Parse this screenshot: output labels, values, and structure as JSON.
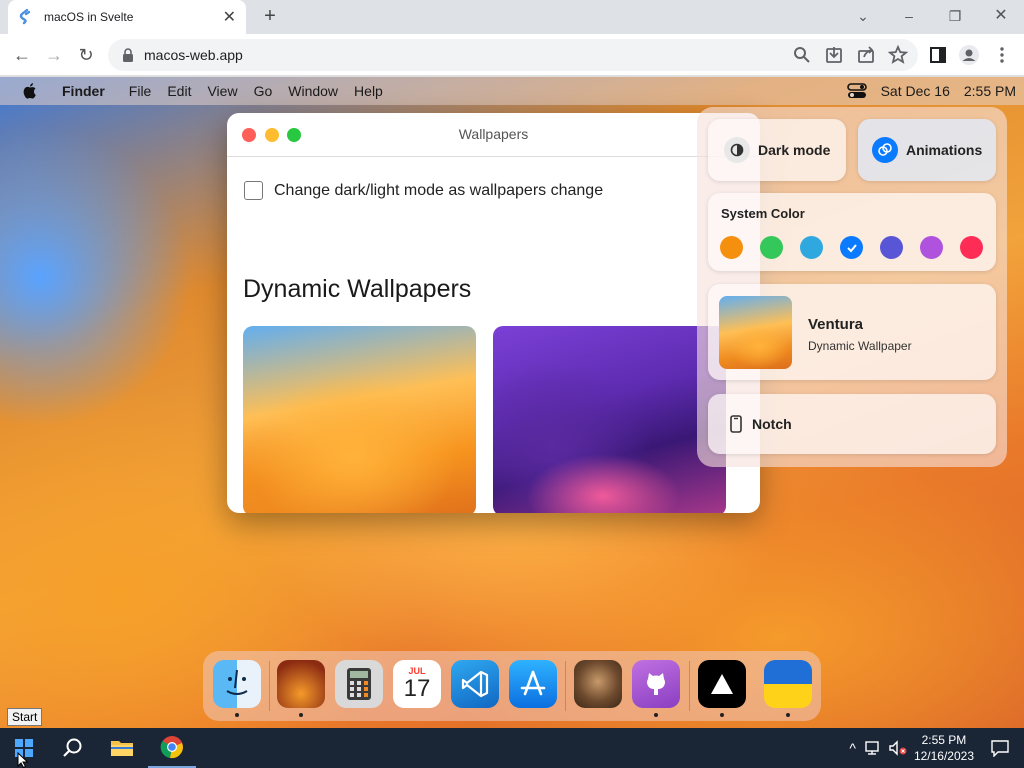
{
  "browser": {
    "tab_title": "macOS in Svelte",
    "url": "macos-web.app"
  },
  "menubar": {
    "app_name": "Finder",
    "items": [
      "File",
      "Edit",
      "View",
      "Go",
      "Window",
      "Help"
    ],
    "date": "Sat Dec 16",
    "time": "2:55 PM"
  },
  "wallpapers_window": {
    "title": "Wallpapers",
    "checkbox_label": "Change dark/light mode as wallpapers change",
    "checkbox_checked": false,
    "section_heading": "Dynamic Wallpapers"
  },
  "control_center": {
    "dark_mode_label": "Dark mode",
    "animations_label": "Animations",
    "system_color_label": "System Color",
    "colors": [
      "#f5900e",
      "#34c759",
      "#2fa8e0",
      "#0a7aff",
      "#5856d6",
      "#af52de",
      "#ff2d55"
    ],
    "selected_color": "#0a7aff",
    "wallpaper_name": "Ventura",
    "wallpaper_type": "Dynamic Wallpaper",
    "notch_label": "Notch"
  },
  "dock": {
    "calendar_month": "JUL",
    "calendar_day": "17"
  },
  "taskbar": {
    "start_tooltip": "Start",
    "clock_time": "2:55 PM",
    "clock_date": "12/16/2023"
  }
}
